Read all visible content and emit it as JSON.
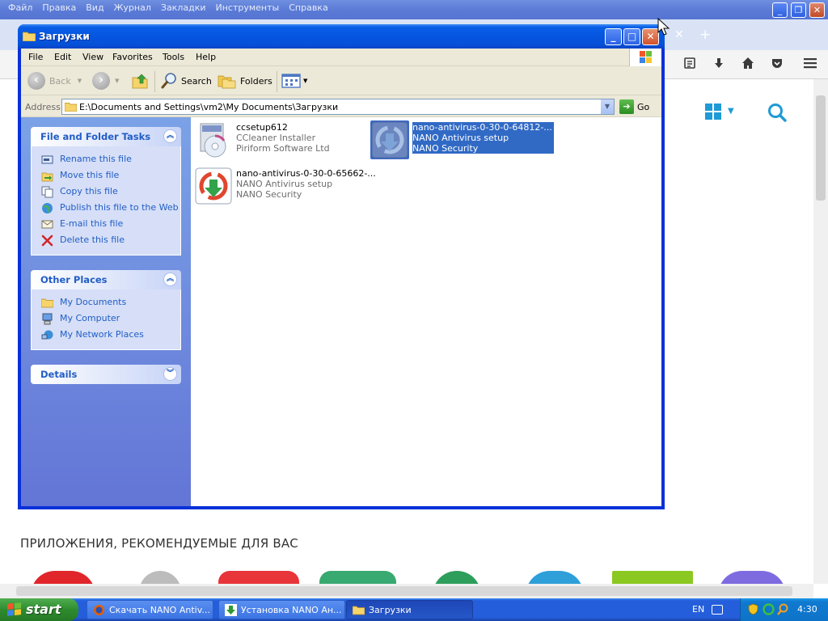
{
  "firefox": {
    "menu": [
      "Файл",
      "Правка",
      "Вид",
      "Журнал",
      "Закладки",
      "Инструменты",
      "Справка"
    ],
    "section_heading": "ПРИЛОЖЕНИЯ, РЕКОМЕНДУЕМЫЕ ДЛЯ ВАС",
    "nav_icons": [
      "reading-list-icon",
      "download-icon",
      "home-icon",
      "pocket-icon",
      "menu-icon"
    ],
    "accent": "#1e9ad6"
  },
  "explorer": {
    "title": "Загрузки",
    "menu": [
      "File",
      "Edit",
      "View",
      "Favorites",
      "Tools",
      "Help"
    ],
    "toolbar": {
      "back": "Back",
      "search": "Search",
      "folders": "Folders"
    },
    "address": {
      "label": "Address",
      "path": "E:\\Documents and Settings\\vm2\\My Documents\\Загрузки",
      "go": "Go"
    },
    "tasks": {
      "file_folder": {
        "title": "File and Folder Tasks",
        "items": [
          {
            "label": "Rename this file",
            "icon": "rename-icon"
          },
          {
            "label": "Move this file",
            "icon": "move-icon"
          },
          {
            "label": "Copy this file",
            "icon": "copy-icon"
          },
          {
            "label": "Publish this file to the Web",
            "icon": "publish-web-icon"
          },
          {
            "label": "E-mail this file",
            "icon": "email-icon"
          },
          {
            "label": "Delete this file",
            "icon": "delete-icon"
          }
        ]
      },
      "other_places": {
        "title": "Other Places",
        "items": [
          {
            "label": "My Documents",
            "icon": "folder-icon"
          },
          {
            "label": "My Computer",
            "icon": "computer-icon"
          },
          {
            "label": "My Network Places",
            "icon": "network-icon"
          }
        ]
      },
      "details": {
        "title": "Details"
      }
    },
    "files": [
      {
        "name": "ccsetup612",
        "type": "CCleaner Installer",
        "company": "Piriform Software Ltd",
        "icon": "ccleaner-icon",
        "selected": false
      },
      {
        "name": "nano-antivirus-0-30-0-64812-...",
        "type": "NANO Antivirus setup",
        "company": "NANO Security",
        "icon": "nano-antivirus-icon",
        "selected": true
      },
      {
        "name": "nano-antivirus-0-30-0-65662-...",
        "type": "NANO Antivirus setup",
        "company": "NANO Security",
        "icon": "nano-antivirus-icon",
        "selected": false
      }
    ]
  },
  "taskbar": {
    "start": "start",
    "tasks": [
      {
        "label": "Скачать NANO Antiv...",
        "icon": "firefox-icon",
        "active": false
      },
      {
        "label": "Установка NANO Ан...",
        "icon": "installer-icon",
        "active": false
      },
      {
        "label": "Загрузки",
        "icon": "folder-icon",
        "active": true
      }
    ],
    "language": "EN",
    "clock": "4:30"
  }
}
